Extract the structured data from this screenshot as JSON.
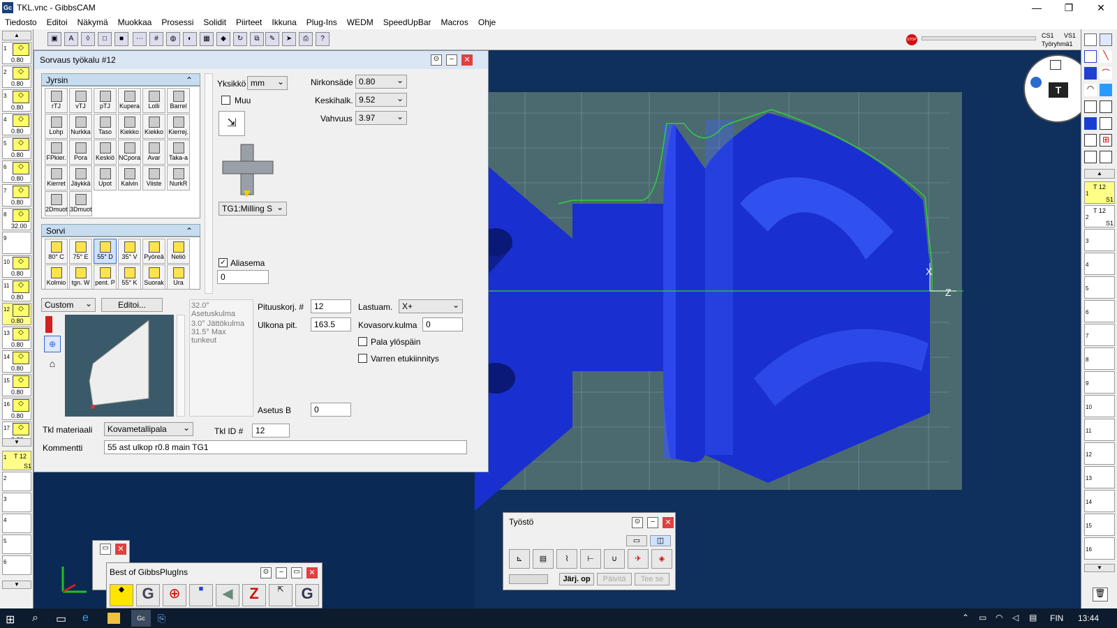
{
  "window": {
    "title": "TKL.vnc - GibbsCAM",
    "app_icon": "Gc"
  },
  "menu": [
    "Tiedosto",
    "Editoi",
    "Näkymä",
    "Muokkaa",
    "Prosessi",
    "Solidit",
    "Piirteet",
    "Ikkuna",
    "Plug-Ins",
    "WEDM",
    "SpeedUpBar",
    "Macros",
    "Ohje"
  ],
  "status": {
    "cs": "CS1",
    "vs": "VS1",
    "group": "Työryhmä1"
  },
  "left_slots": [
    {
      "n": "1",
      "v": "0.80"
    },
    {
      "n": "2",
      "v": "0.80"
    },
    {
      "n": "3",
      "v": "0.80"
    },
    {
      "n": "4",
      "v": "0.80"
    },
    {
      "n": "5",
      "v": "0.80"
    },
    {
      "n": "6",
      "v": "0.80"
    },
    {
      "n": "7",
      "v": "0.80"
    },
    {
      "n": "8",
      "v": "32.00"
    },
    {
      "n": "9",
      "v": ""
    },
    {
      "n": "10",
      "v": "0.80"
    },
    {
      "n": "11",
      "v": "0.80"
    },
    {
      "n": "12",
      "v": "0.80"
    },
    {
      "n": "13",
      "v": "0.80"
    },
    {
      "n": "14",
      "v": "0.80"
    },
    {
      "n": "15",
      "v": "0.80"
    },
    {
      "n": "16",
      "v": "0.80"
    },
    {
      "n": "17",
      "v": "0.80"
    }
  ],
  "proc_slots": [
    "1",
    "2",
    "3",
    "4",
    "5",
    "6"
  ],
  "right_slots": [
    "1",
    "2",
    "3",
    "4",
    "5",
    "6",
    "7",
    "8",
    "9",
    "10",
    "11",
    "12",
    "13",
    "14",
    "15",
    "16"
  ],
  "proc_chip": {
    "t": "T 12",
    "num": "1",
    "num2": "12",
    "s": "S1"
  },
  "dialog": {
    "title": "Sorvaus työkalu #12",
    "milling_header": "Jyrsin",
    "milling_tools": [
      "rTJ",
      "vTJ",
      "pTJ",
      "Kupera",
      "Lolli",
      "Barrel",
      "Lohp",
      "Nurkka",
      "Taso",
      "Kiekko",
      "Kiekko",
      "Kierrej.",
      "FPkier.",
      "Pora",
      "Keskiö",
      "NCpora",
      "Avar",
      "Taka-a",
      "Kierret",
      "Jäykkä",
      "Upot",
      "Kalvin",
      "Viiste",
      "NurkR",
      "2Dmuot",
      "3Dmuot"
    ],
    "turning_header": "Sorvi",
    "turning_tools": [
      "80° C",
      "75° E",
      "55° D",
      "35° V",
      "Pyöreä",
      "Neliö",
      "Kolmio",
      "tgn. W",
      "pent. P",
      "55° K",
      "Suorak",
      "Ura"
    ],
    "unit_label": "Yksikkö",
    "unit_value": "mm",
    "muu_label": "Muu",
    "tool_group": "TG1:Milling S",
    "alias_label": "Aliasema",
    "alias_value": "0",
    "nose_label": "Nirkonsäde",
    "nose_value": "0.80",
    "ic_label": "Keskihalk.",
    "ic_value": "9.52",
    "thick_label": "Vahvuus",
    "thick_value": "3.97",
    "insert_combo": "Custom",
    "edit_button": "Editoi...",
    "angles": [
      "32.0° Asetuskulma",
      "3.0° Jättökulma",
      "31.5° Max tunkeut"
    ],
    "length_comp_label": "Pituuskorj. #",
    "length_comp_value": "12",
    "outer_len_label": "Ulkona pit.",
    "outer_len_value": "163.5",
    "coolant_label": "Lastuam.",
    "coolant_value": "X+",
    "hardturn_label": "Kovasorv.kulma",
    "hardturn_value": "0",
    "insert_up_label": "Pala ylöspäin",
    "shank_label": "Varren etukiinnitys",
    "setb_label": "Asetus B",
    "setb_value": "0",
    "material_label": "Tkl materiaali",
    "material_value": "Kovametallipala",
    "toolid_label": "Tkl ID #",
    "toolid_value": "12",
    "comment_label": "Kommentti",
    "comment_value": "55 ast ulkop r0.8 main TG1"
  },
  "tyosto": {
    "title": "Työstö",
    "buttons": [
      "Järj. op",
      "Päivitä",
      "Tee se"
    ]
  },
  "plugins": {
    "title": "Best of GibbsPlugIns"
  },
  "viewport": {
    "axis_x": "X",
    "axis_z": "Z"
  },
  "taskbar": {
    "lang": "FIN",
    "time": "13:44"
  },
  "colors": {
    "part": "#1a2fd0",
    "viewport_bg": "#0f2f5d",
    "stock": "#4a6a70",
    "toolpath": "#2dd040"
  }
}
